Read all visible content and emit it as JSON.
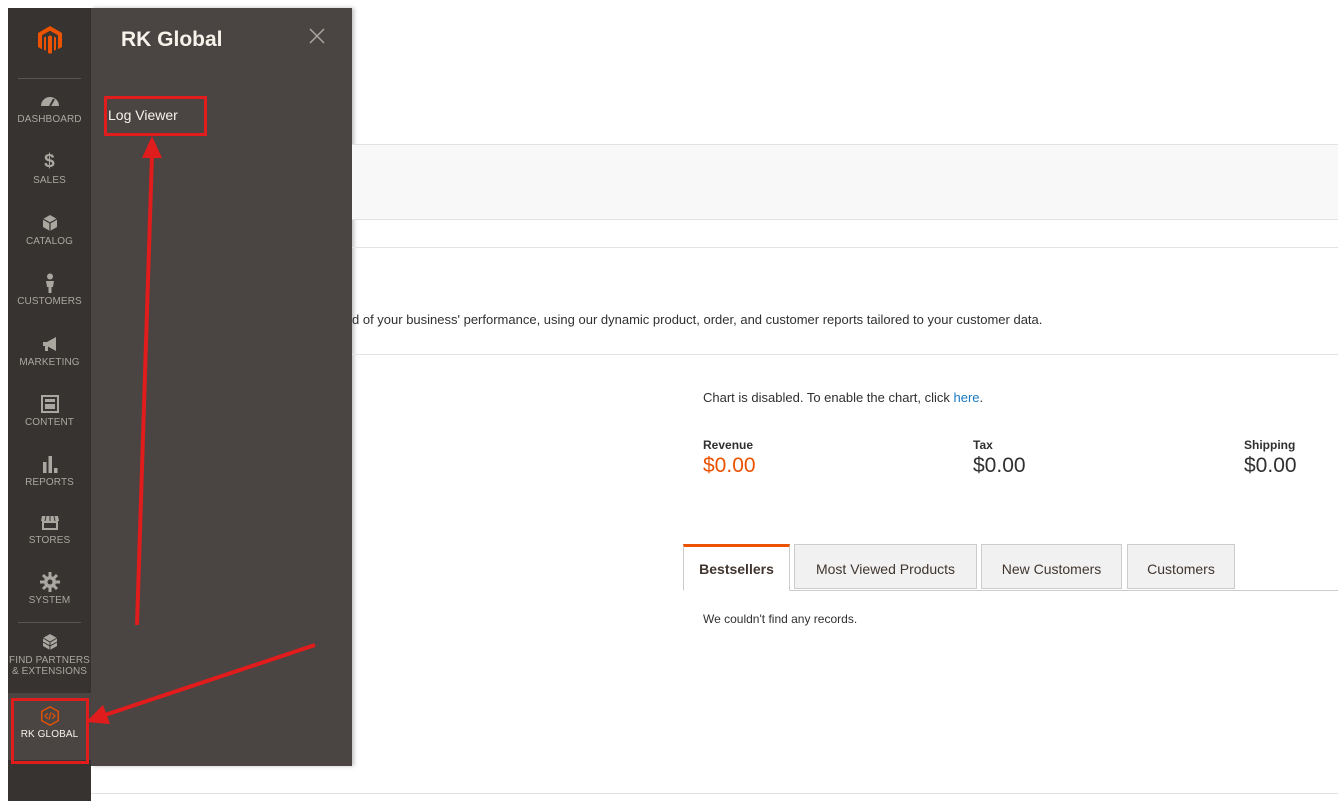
{
  "nav": {
    "items": [
      {
        "label": "DASHBOARD",
        "icon": "dashboard-icon"
      },
      {
        "label": "$",
        "icon": "dollar-icon"
      },
      {
        "label": "SALES"
      },
      {
        "label": "CATALOG",
        "icon": "box-icon"
      },
      {
        "label": "CUSTOMERS",
        "icon": "person-icon"
      },
      {
        "label": "MARKETING",
        "icon": "megaphone-icon"
      },
      {
        "label": "CONTENT",
        "icon": "layout-icon"
      },
      {
        "label": "REPORTS",
        "icon": "bar-chart-icon"
      },
      {
        "label": "STORES",
        "icon": "storefront-icon"
      },
      {
        "label": "SYSTEM",
        "icon": "gear-icon"
      },
      {
        "label_line1": "FIND PARTNERS",
        "label_line2": "& EXTENSIONS",
        "icon": "extensions-icon"
      },
      {
        "label": "RK GLOBAL",
        "icon": "code-icon"
      }
    ]
  },
  "panel": {
    "title": "RK Global",
    "link": "Log Viewer"
  },
  "main": {
    "info_text": "d of your business' performance, using our dynamic product, order, and customer reports tailored to your customer data.",
    "chart_msg_prefix": "Chart is disabled. To enable the chart, click ",
    "chart_msg_link": "here",
    "chart_msg_suffix": ".",
    "stats": [
      {
        "name": "Revenue",
        "value": "$0.00"
      },
      {
        "name": "Tax",
        "value": "$0.00"
      },
      {
        "name": "Shipping",
        "value": "$0.00"
      }
    ],
    "tabs": [
      "Bestsellers",
      "Most Viewed Products",
      "New Customers",
      "Customers"
    ],
    "no_records": "We couldn't find any records."
  },
  "colors": {
    "accent": "#eb5202",
    "annotation": "#e01c1c",
    "link": "#1979c3"
  }
}
